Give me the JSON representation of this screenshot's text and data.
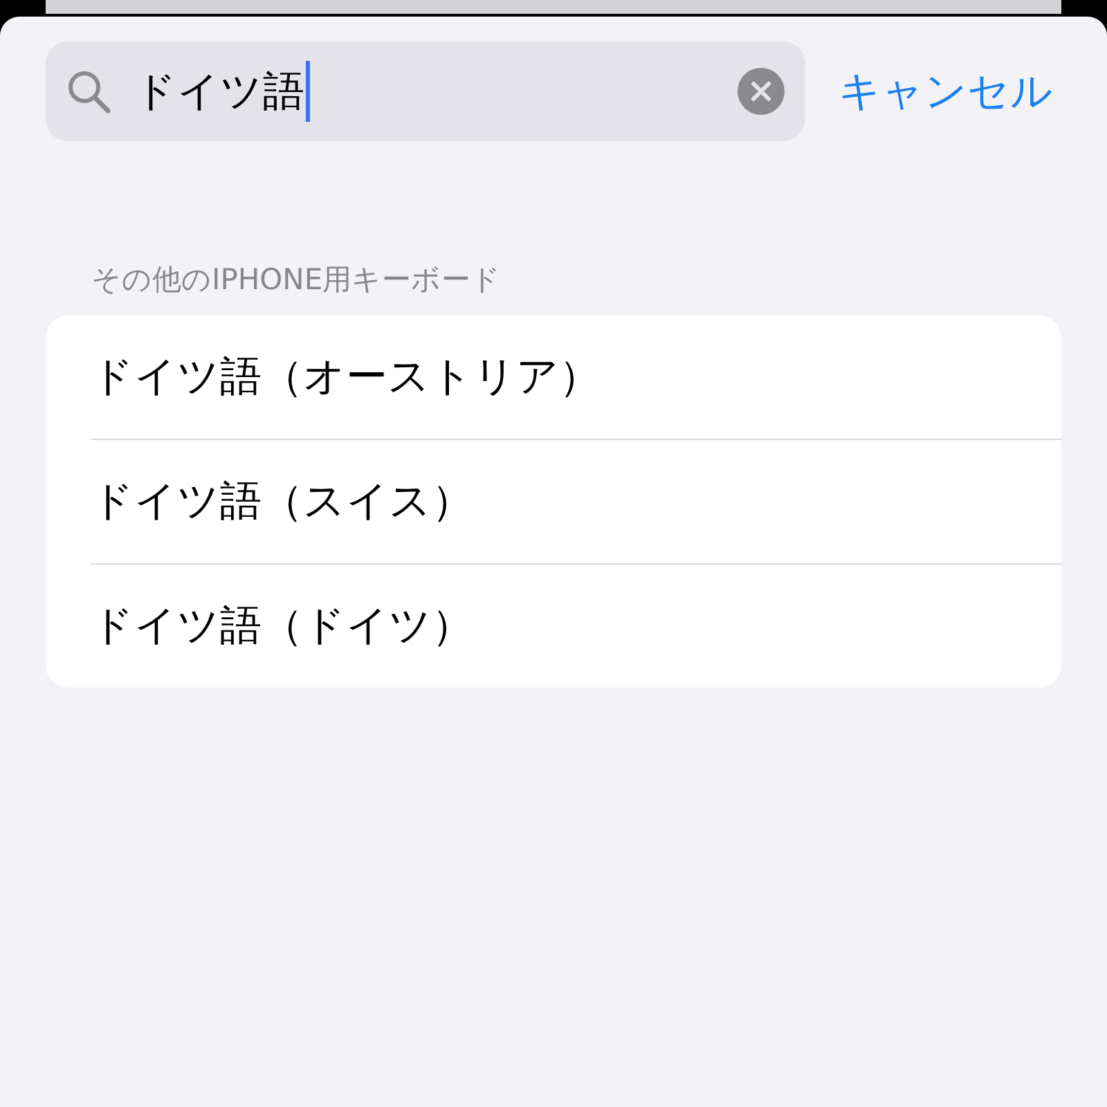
{
  "search": {
    "value": "ドイツ語"
  },
  "cancel": "キャンセル",
  "section": {
    "header": "その他のIPHONE用キーボード",
    "items": [
      {
        "label": "ドイツ語（オーストリア）"
      },
      {
        "label": "ドイツ語（スイス）"
      },
      {
        "label": "ドイツ語（ドイツ）"
      }
    ]
  }
}
